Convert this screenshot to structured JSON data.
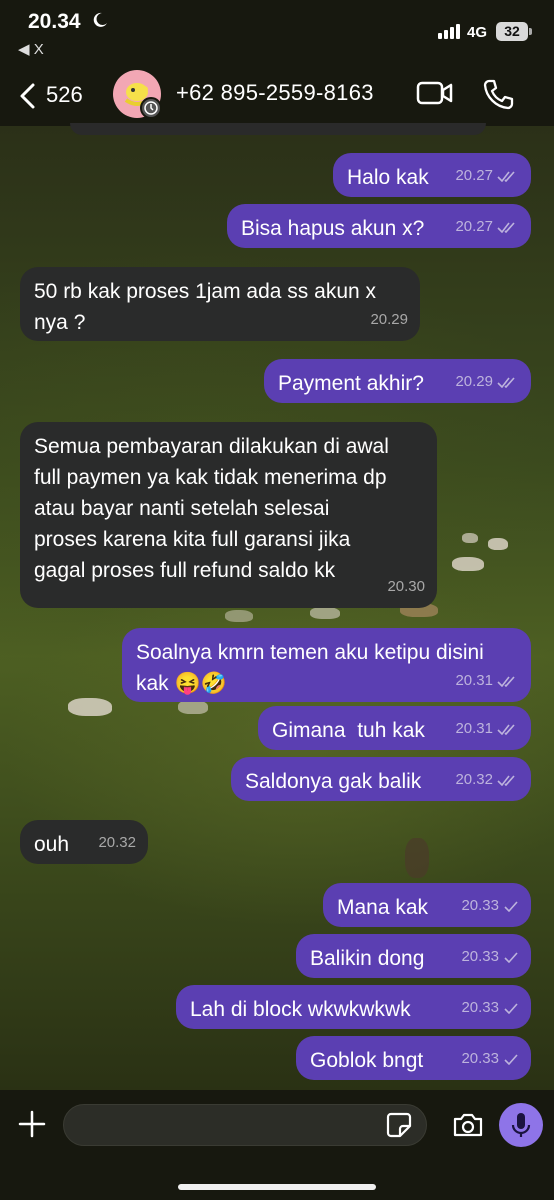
{
  "status_bar": {
    "time": "20.34",
    "back_app": "◀ X",
    "network": "4G",
    "battery": "32"
  },
  "header": {
    "unread_count": "526",
    "contact_name": "+62 895-2559-8163"
  },
  "messages": [
    {
      "dir": "out",
      "text": "Halo kak",
      "time": "20.27",
      "status": "read"
    },
    {
      "dir": "out",
      "text": "Bisa hapus akun x?",
      "time": "20.27",
      "status": "read"
    },
    {
      "dir": "in",
      "text": "50 rb kak proses 1jam ada ss akun x\nnya ?",
      "time": "20.29"
    },
    {
      "dir": "out",
      "text": "Payment akhir?",
      "time": "20.29",
      "status": "read"
    },
    {
      "dir": "in",
      "text": "Semua pembayaran dilakukan di awal\nfull paymen ya kak tidak menerima dp\natau bayar nanti setelah selesai\nproses karena kita full garansi jika\ngagal proses full refund saldo kk",
      "time": "20.30"
    },
    {
      "dir": "out",
      "text": "Soalnya kmrn temen aku ketipu disini\nkak 😝🤣",
      "time": "20.31",
      "status": "read"
    },
    {
      "dir": "out",
      "text": "Gimana  tuh kak",
      "time": "20.31",
      "status": "read"
    },
    {
      "dir": "out",
      "text": "Saldonya gak balik",
      "time": "20.32",
      "status": "read"
    },
    {
      "dir": "in",
      "text": "ouh",
      "time": "20.32"
    },
    {
      "dir": "out",
      "text": "Mana kak",
      "time": "20.33",
      "status": "sent"
    },
    {
      "dir": "out",
      "text": "Balikin dong",
      "time": "20.33",
      "status": "sent"
    },
    {
      "dir": "out",
      "text": "Lah di block wkwkwkwk",
      "time": "20.33",
      "status": "sent"
    },
    {
      "dir": "out",
      "text": "Goblok bngt",
      "time": "20.33",
      "status": "sent"
    }
  ],
  "composer": {
    "value": "",
    "placeholder": ""
  },
  "colors": {
    "outgoing_bubble": "#5b3fb2",
    "incoming_bubble": "#2a2b2b",
    "accent": "#8e74e8",
    "bar_background": "#17180f"
  }
}
